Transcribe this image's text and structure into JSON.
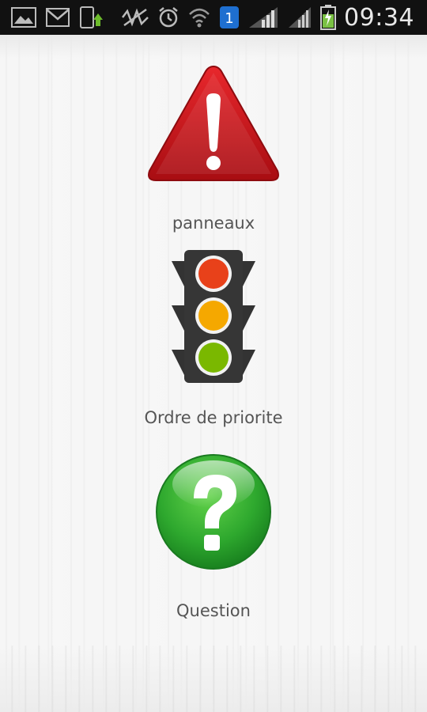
{
  "status_bar": {
    "time": "09:34",
    "notification_badge": "1",
    "icons": [
      "image-icon",
      "gmail-icon",
      "download-icon",
      "mute-icon",
      "alarm-icon",
      "wifi-icon",
      "signal-icon",
      "battery-icon"
    ]
  },
  "menu": {
    "items": [
      {
        "label": "panneaux",
        "icon": "warning-sign-icon"
      },
      {
        "label": "Ordre de priorite",
        "icon": "traffic-light-icon"
      },
      {
        "label": "Question",
        "icon": "question-icon"
      }
    ]
  },
  "colors": {
    "warning_red": "#c4161c",
    "traffic_red": "#e8411a",
    "traffic_amber": "#f5a800",
    "traffic_green": "#7ab800",
    "question_green": "#2ea82e",
    "label_gray": "#555555"
  }
}
